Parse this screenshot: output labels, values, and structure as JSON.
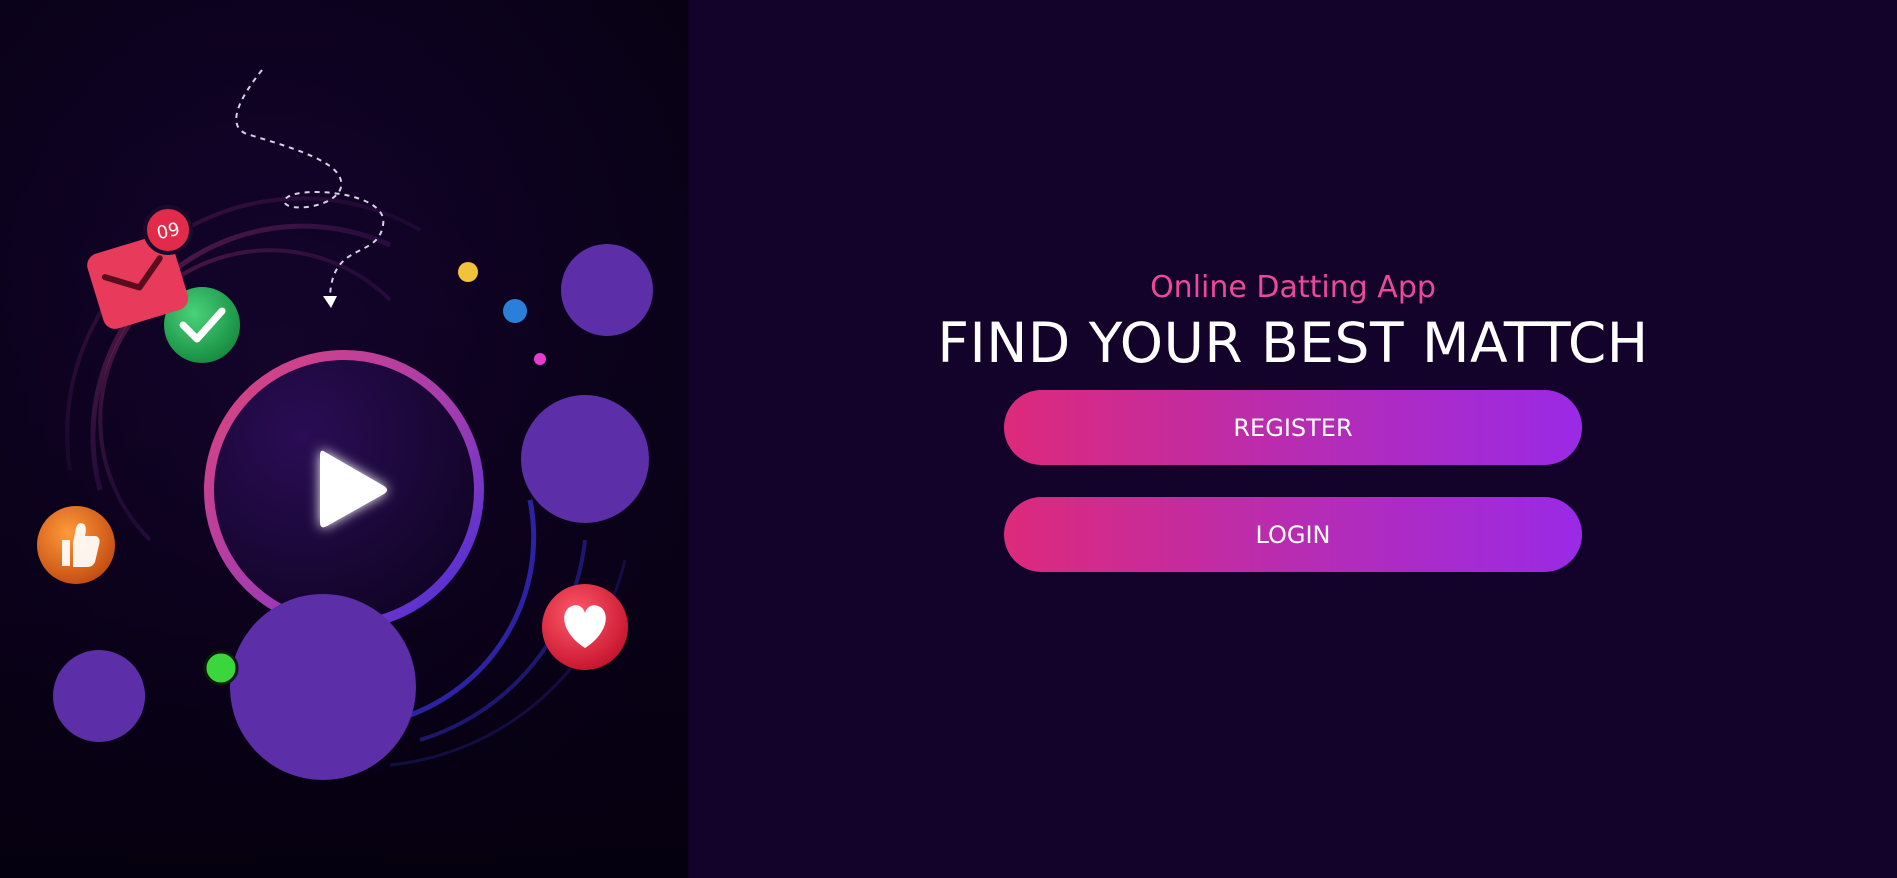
{
  "hero": {
    "notification_count": "09",
    "icons": [
      "play-icon",
      "heart-icon",
      "thumbs-up-icon",
      "check-icon",
      "mail-icon"
    ]
  },
  "main": {
    "subtitle": "Online Datting App",
    "headline": "FIND YOUR BEST MATTCH",
    "register_label": "REGISTER",
    "login_label": "LOGIN"
  },
  "colors": {
    "background": "#130229",
    "subtitle": "#ea4a9a",
    "button_start": "#dd2a7b",
    "button_end": "#9a2ae6",
    "bubble": "#5c2ea8"
  }
}
